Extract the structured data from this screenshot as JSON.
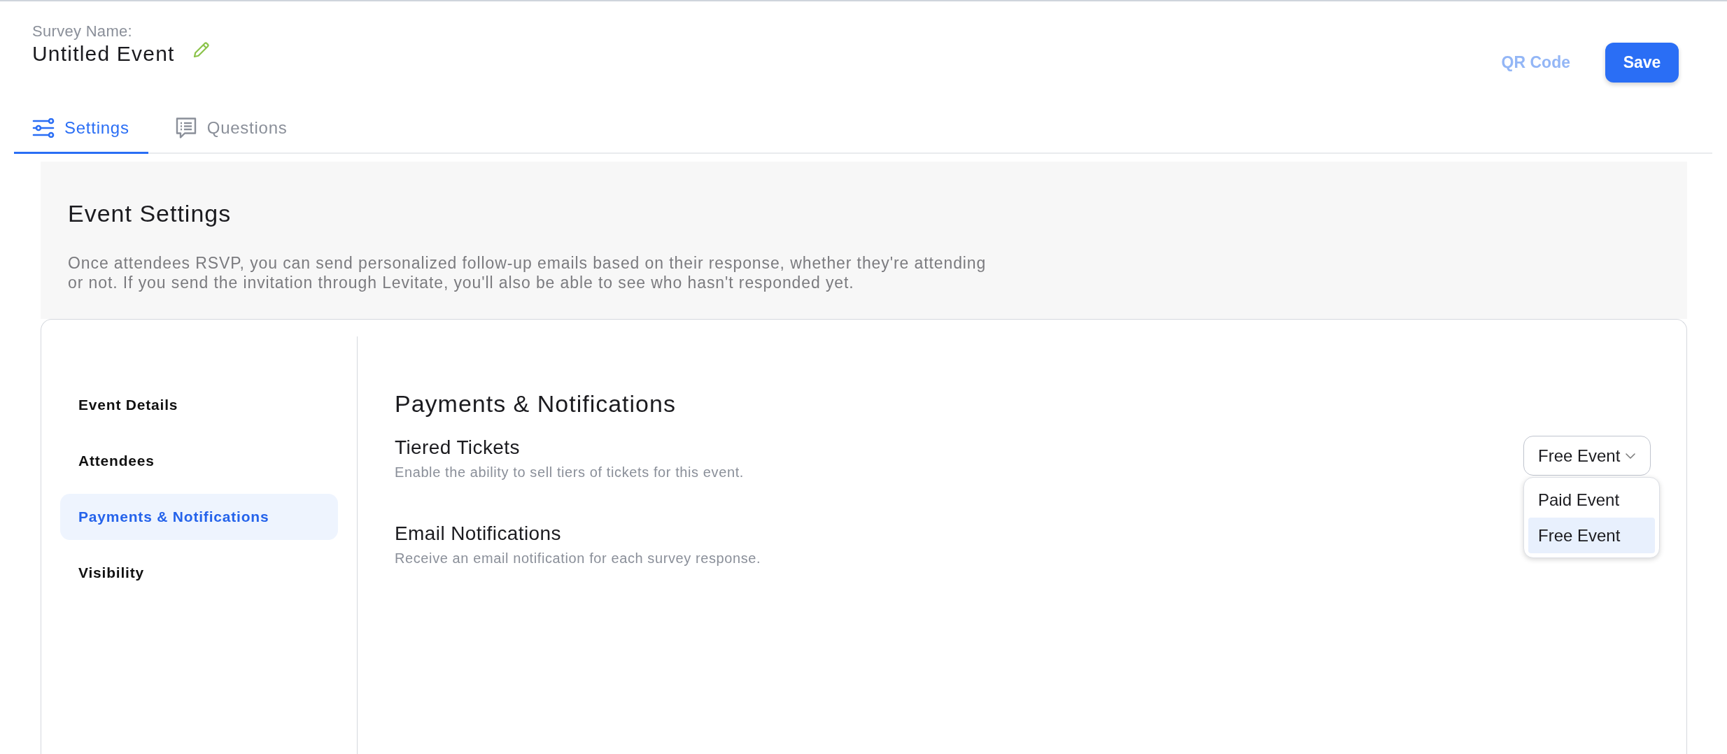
{
  "header": {
    "label": "Survey Name:",
    "title": "Untitled Event",
    "actions": [
      {
        "label": "QR Code",
        "kind": "link"
      },
      {
        "label": "Save",
        "kind": "primary"
      }
    ]
  },
  "tabs": [
    {
      "label": "Settings",
      "selected": true
    },
    {
      "label": "Questions",
      "selected": false
    }
  ],
  "intro": {
    "title": "Event Settings",
    "text": "Once attendees RSVP, you can send personalized follow-up emails based on their response, whether they're attending or not. If you send the invitation through Levitate, you'll also be able to see who hasn't responded yet."
  },
  "sidebar": {
    "items": [
      {
        "label": "Event Details",
        "selected": false
      },
      {
        "label": "Attendees",
        "selected": false
      },
      {
        "label": "Payments & Notifications",
        "selected": true
      },
      {
        "label": "Visibility",
        "selected": false
      }
    ]
  },
  "section": {
    "title": "Payments & Notifications",
    "settings": [
      {
        "title": "Tiered Tickets",
        "description": "Enable the ability to sell tiers of tickets for this event.",
        "control": {
          "kind": "dropdown",
          "value": "Free Event",
          "expanded": true,
          "options": [
            {
              "label": "Paid Event",
              "selected": false
            },
            {
              "label": "Free Event",
              "selected": true
            }
          ]
        }
      },
      {
        "title": "Email Notifications",
        "description": "Receive an email notification for each survey response."
      }
    ]
  }
}
